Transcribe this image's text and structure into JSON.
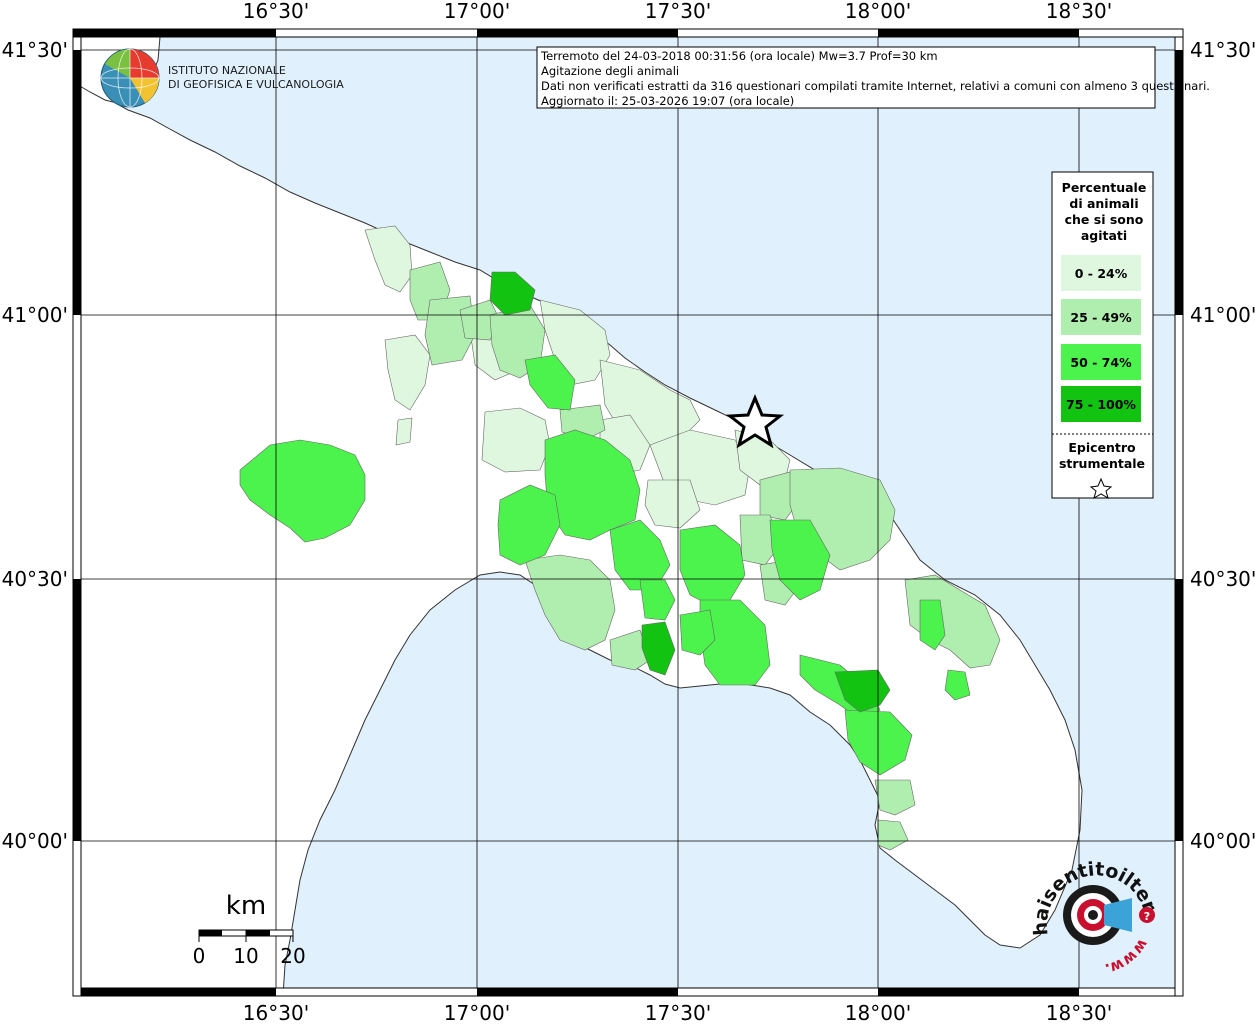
{
  "header": {
    "line1": "Terremoto del 24-03-2018 00:31:56 (ora locale) Mw=3.7 Prof=30 km",
    "line2": "Agitazione degli animali",
    "line3": "Dati non verificati estratti da 316 questionari compilati tramite Internet, relativi a comuni con almeno 3 questionari.",
    "line4": "Aggiornato il: 25-03-2026 19:07 (ora locale)"
  },
  "logo": {
    "line1": "ISTITUTO NAZIONALE",
    "line2": "DI GEOFISICA E VULCANOLOGIA"
  },
  "axes": {
    "lon_labels": [
      "16°30'",
      "17°00'",
      "17°30'",
      "18°00'",
      "18°30'"
    ],
    "lat_labels": [
      "41°30'",
      "41°00'",
      "40°30'",
      "40°00'"
    ]
  },
  "legend": {
    "title_lines": [
      "Percentuale",
      "di animali",
      "che si sono",
      "agitati"
    ],
    "classes": [
      {
        "label": "0 - 24%",
        "color": "#dff7df"
      },
      {
        "label": "25 - 49%",
        "color": "#b0eeb0"
      },
      {
        "label": "50 - 74%",
        "color": "#4cf34c"
      },
      {
        "label": "75 - 100%",
        "color": "#12c312"
      }
    ],
    "epicenter_lines": [
      "Epicentro",
      "strumentale"
    ]
  },
  "scale": {
    "unit": "km",
    "ticks": [
      "0",
      "10",
      "20"
    ]
  },
  "hst_logo": {
    "ring_text": "haisentitoilterremoto.it",
    "www_text": "www."
  },
  "colors": {
    "sea": "#e0f0fc",
    "land": "#ffffff",
    "epicenter_star": "#000000"
  }
}
